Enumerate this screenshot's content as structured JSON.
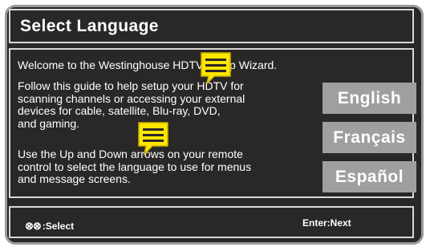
{
  "title": "Select Language",
  "content": {
    "welcome": "Welcome to the Westinghouse HDTV Setup Wizard.",
    "follow_lines": [
      "Follow this guide to help setup your HDTV for",
      "scanning channels or accessing your external",
      "devices for cable, satellite, Blu-ray, DVD,",
      "and gaming."
    ],
    "updown_lines": [
      "Use the Up and Down arrows on your remote",
      "control to select the language to use for menus",
      "and message screens."
    ]
  },
  "languages": [
    "English",
    "Français",
    "Español"
  ],
  "footer": {
    "select_icon": "⊗⊗",
    "select_label": ":Select",
    "next_label": "Enter:Next"
  },
  "colors": {
    "background": "#2a2727",
    "button": "#a09e9e",
    "note_yellow": "#ffe600"
  },
  "icons": [
    "sticky-note-icon",
    "sticky-note-icon"
  ]
}
